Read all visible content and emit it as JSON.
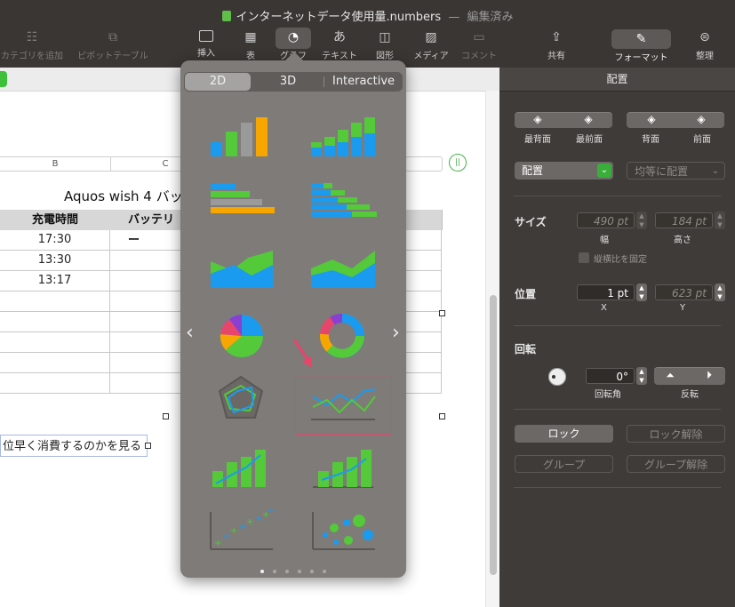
{
  "window": {
    "title": "インターネットデータ使用量.numbers",
    "separator": "—",
    "status": "編集済み"
  },
  "toolbar": {
    "items": [
      {
        "label": "カテゴリを追加",
        "icon": "list-icon"
      },
      {
        "label": "ピボットテーブル",
        "icon": "pivot-icon"
      },
      {
        "label": "挿入",
        "icon": "insert-icon"
      },
      {
        "label": "表",
        "icon": "table-icon"
      },
      {
        "label": "グラフ",
        "icon": "chart-icon"
      },
      {
        "label": "テキスト",
        "icon": "text-icon"
      },
      {
        "label": "図形",
        "icon": "shape-icon"
      },
      {
        "label": "メディア",
        "icon": "media-icon"
      },
      {
        "label": "コメント",
        "icon": "comment-icon"
      },
      {
        "label": "共有",
        "icon": "share-icon"
      },
      {
        "label": "フォーマット",
        "icon": "format-brush-icon"
      },
      {
        "label": "整理",
        "icon": "organize-icon"
      }
    ]
  },
  "sheet": {
    "columns": [
      "B",
      "C"
    ],
    "table_title": "Aquos wish 4 バッ",
    "headers": [
      "充電時間",
      "バッテリー"
    ],
    "rows": [
      [
        "17:30",
        ""
      ],
      [
        "13:30",
        ""
      ],
      [
        "13:17",
        ""
      ],
      [
        "",
        ""
      ],
      [
        "",
        ""
      ],
      [
        "",
        ""
      ],
      [
        "",
        ""
      ],
      [
        "",
        ""
      ]
    ],
    "caption": "位早く消費するのかを見る"
  },
  "chart_popover": {
    "tabs": [
      "2D",
      "3D",
      "Interactive"
    ],
    "active_tab": "2D",
    "page_count": 6,
    "active_page": 0,
    "colors": {
      "blue": "#1a9bf0",
      "green": "#54c93a",
      "orange": "#f7a600",
      "gray": "#9a9a9a",
      "highlight": "#e8456b"
    }
  },
  "inspector": {
    "title": "配置",
    "layer_buttons": [
      "最背面",
      "最前面",
      "背面",
      "前面"
    ],
    "arrange_dropdown": "配置",
    "distribute_dropdown": "均等に配置",
    "size": {
      "label": "サイズ",
      "width_value": "490 pt",
      "width_label": "幅",
      "height_value": "184 pt",
      "height_label": "高さ",
      "constrain_label": "縦横比を固定"
    },
    "position": {
      "label": "位置",
      "x_value": "1 pt",
      "x_label": "X",
      "y_value": "623 pt",
      "y_label": "Y"
    },
    "rotate": {
      "label": "回転",
      "angle_value": "0°",
      "angle_label": "回転角",
      "flip_label": "反転"
    },
    "lock_button": "ロック",
    "unlock_button": "ロック解除",
    "group_button": "グループ",
    "ungroup_button": "グループ解除"
  }
}
